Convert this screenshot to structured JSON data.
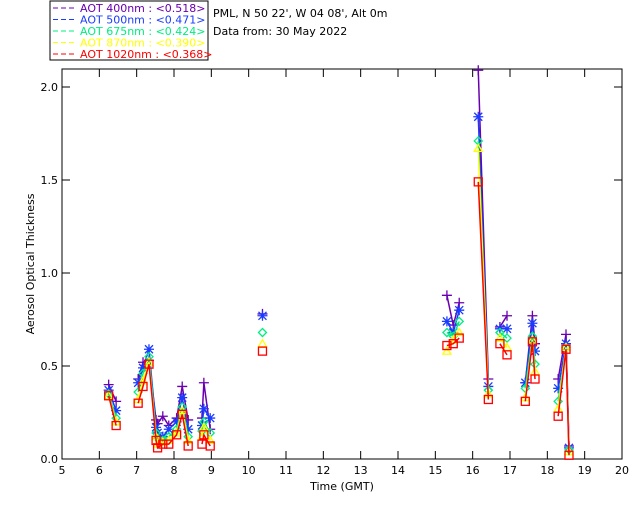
{
  "header": {
    "site": "PML, N 50 22', W 04 08', Alt 0m",
    "date": "Data from: 30 May 2022"
  },
  "chart_data": {
    "type": "line",
    "xlabel": "Time (GMT)",
    "ylabel": "Aerosol Optical Thickness",
    "xlim": [
      5,
      20
    ],
    "ylim": [
      0,
      2.0
    ],
    "x_ticks": [
      "5",
      "6",
      "7",
      "8",
      "9",
      "10",
      "11",
      "12",
      "13",
      "14",
      "15",
      "16",
      "17",
      "18",
      "19",
      "20"
    ],
    "y_ticks": [
      "0.0",
      "0.5",
      "1.0",
      "1.5",
      "2.0"
    ],
    "legend_position": "top-left, outside",
    "x": [
      6.25,
      6.45,
      7.04,
      7.17,
      7.33,
      7.52,
      7.56,
      7.7,
      7.86,
      8.07,
      8.22,
      8.38,
      8.75,
      8.8,
      8.97,
      10.37,
      15.31,
      15.48,
      15.64,
      16.15,
      16.42,
      16.73,
      16.92,
      17.41,
      17.6,
      17.67,
      18.29,
      18.5,
      18.58
    ],
    "series": [
      {
        "name": "AOT  400nm : <0.518>",
        "color": "#6a00b0",
        "marker": "plus",
        "values": [
          0.4,
          0.31,
          0.43,
          0.52,
          0.53,
          0.21,
          0.19,
          0.23,
          0.18,
          0.22,
          0.39,
          0.21,
          0.22,
          0.41,
          0.16,
          0.78,
          0.88,
          0.72,
          0.84,
          2.09,
          0.43,
          0.71,
          0.77,
          0.41,
          0.77,
          0.62,
          0.43,
          0.67,
          0.07
        ]
      },
      {
        "name": "AOT  500nm : <0.471>",
        "color": "#1a3cff",
        "marker": "asterisk",
        "values": [
          0.37,
          0.26,
          0.41,
          0.49,
          0.59,
          0.17,
          0.14,
          0.12,
          0.16,
          0.2,
          0.33,
          0.16,
          0.18,
          0.27,
          0.22,
          0.77,
          0.74,
          0.68,
          0.8,
          1.84,
          0.39,
          0.7,
          0.7,
          0.41,
          0.73,
          0.58,
          0.38,
          0.62,
          0.06
        ]
      },
      {
        "name": "AOT  675nm : <0.424>",
        "color": "#00ee80",
        "marker": "diamond",
        "values": [
          0.35,
          0.22,
          0.36,
          0.46,
          0.55,
          0.14,
          0.11,
          0.1,
          0.12,
          0.16,
          0.28,
          0.12,
          0.15,
          0.2,
          0.14,
          0.68,
          0.68,
          0.66,
          0.74,
          1.71,
          0.37,
          0.68,
          0.65,
          0.38,
          0.66,
          0.51,
          0.31,
          0.6,
          0.05
        ]
      },
      {
        "name": "AOT  870nm : <0.390>",
        "color": "#ffff00",
        "marker": "triangle",
        "values": [
          0.34,
          0.2,
          0.32,
          0.42,
          0.52,
          0.12,
          0.08,
          0.09,
          0.1,
          0.14,
          0.26,
          0.1,
          0.12,
          0.17,
          0.1,
          0.62,
          0.58,
          0.64,
          0.68,
          1.67,
          0.35,
          0.65,
          0.6,
          0.33,
          0.64,
          0.47,
          0.27,
          0.6,
          0.04
        ]
      },
      {
        "name": "AOT 1020nm : <0.368>",
        "color": "#ff0000",
        "marker": "square",
        "values": [
          0.34,
          0.18,
          0.3,
          0.39,
          0.51,
          0.1,
          0.06,
          0.08,
          0.08,
          0.13,
          0.24,
          0.07,
          0.08,
          0.13,
          0.07,
          0.58,
          0.61,
          0.62,
          0.65,
          1.49,
          0.32,
          0.62,
          0.56,
          0.31,
          0.63,
          0.43,
          0.23,
          0.59,
          0.02
        ]
      }
    ]
  }
}
